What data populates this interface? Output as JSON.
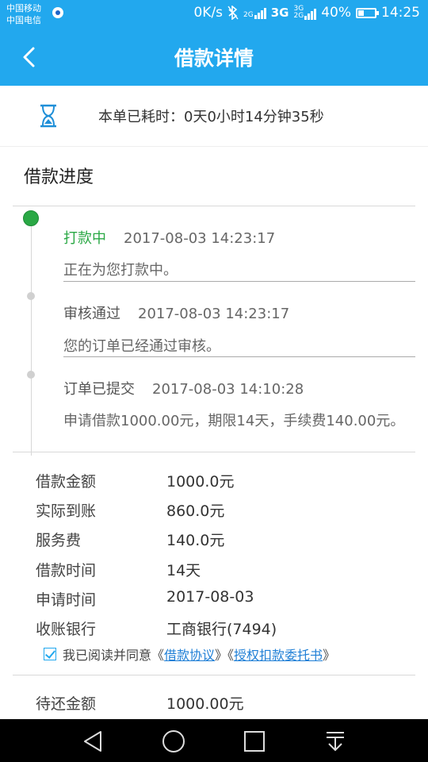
{
  "status_bar": {
    "carrier_1": "中国移动",
    "carrier_2": "中国电信",
    "net_speed": "0K/s",
    "net_2g": "2G",
    "net_3g": "3G",
    "net_3g_small": "3G",
    "net_2g_small": "2G",
    "battery": "40%",
    "battery_level": 0.4,
    "time": "14:25"
  },
  "header": {
    "title": "借款详情"
  },
  "timer": {
    "text": "本单已耗时：0天0小时14分钟35秒"
  },
  "progress": {
    "title": "借款进度",
    "steps": [
      {
        "state": "打款中",
        "time": "2017-08-03 14:23:17",
        "desc": "正在为您打款中。"
      },
      {
        "state": "审核通过",
        "time": "2017-08-03 14:23:17",
        "desc": "您的订单已经通过审核。"
      },
      {
        "state": "订单已提交",
        "time": "2017-08-03 14:10:28",
        "desc": "申请借款1000.00元，期限14天，手续费140.00元。"
      }
    ]
  },
  "details": [
    {
      "label": "借款金额",
      "value": "1000.0元"
    },
    {
      "label": "实际到账",
      "value": "860.0元"
    },
    {
      "label": "服务费",
      "value": "140.0元"
    },
    {
      "label": "借款时间",
      "value": "14天"
    },
    {
      "label": "申请时间",
      "value": "2017-08-03"
    },
    {
      "label": "收账银行",
      "value": "工商银行(7494)"
    }
  ],
  "agreement": {
    "prefix": "我已阅读并同意《",
    "link1": "借款协议",
    "middle": "》《",
    "link2": "授权扣款委托书",
    "suffix": "》"
  },
  "repay": {
    "label": "待还金额",
    "value": "1000.00元"
  },
  "colors": {
    "brand": "#22a8ee",
    "success": "#2aa845",
    "link": "#1f7fd6"
  },
  "icons": [
    "back-icon",
    "hourglass-icon",
    "nav-back-icon",
    "nav-home-icon",
    "nav-recents-icon",
    "nav-notification-icon"
  ]
}
